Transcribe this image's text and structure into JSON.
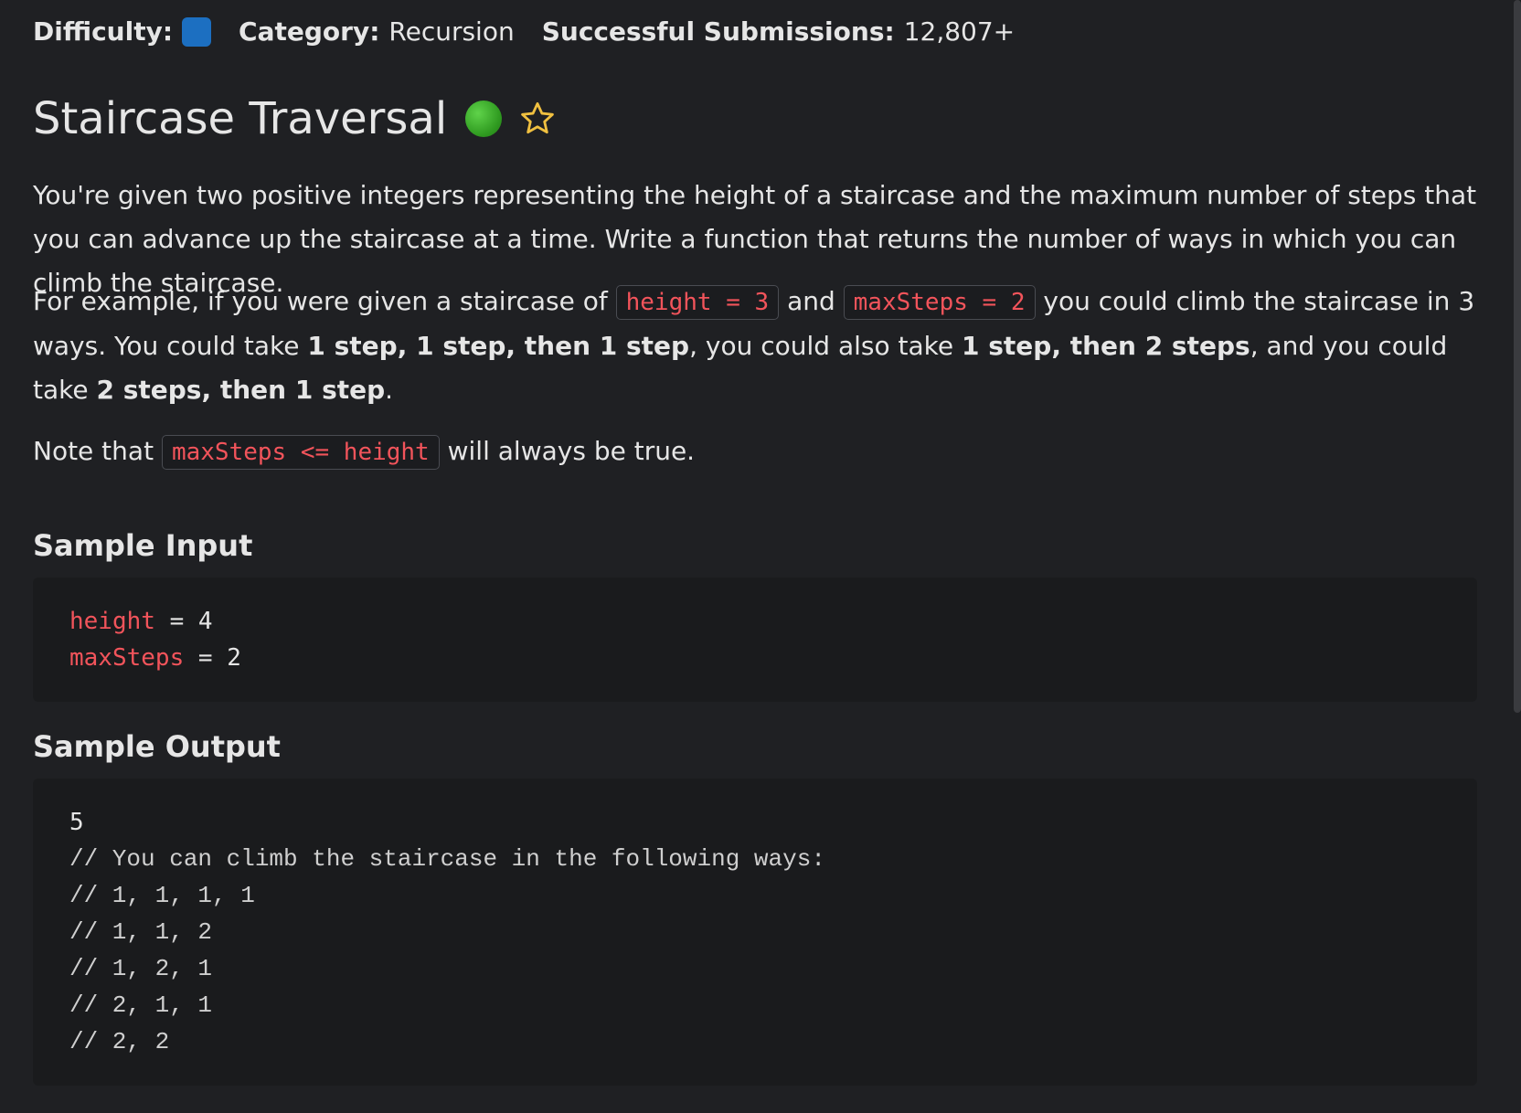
{
  "meta": {
    "difficulty_label": "Difficulty:",
    "difficulty_color": "#1c6fc1",
    "category_label": "Category:",
    "category_value": "Recursion",
    "submissions_label": "Successful Submissions:",
    "submissions_value": "12,807+"
  },
  "title": "Staircase Traversal",
  "status_icon": "green-dot-icon",
  "favorite_icon": "star-icon",
  "description": {
    "p1": "You're given two positive integers representing the height of a staircase and the maximum number of steps that you can advance up the staircase at a time. Write a function that returns the number of ways in which you can climb the staircase.",
    "p2_a": "For example, if you were given a staircase of ",
    "p2_code1": "height = 3",
    "p2_b": " and ",
    "p2_code2": "maxSteps = 2",
    "p2_c": " you could climb the staircase in 3 ways. You could take ",
    "p2_bold1": "1 step, 1 step, then 1 step",
    "p2_d": ", you could also take ",
    "p2_bold2": "1 step, then 2 steps",
    "p2_e": ", and you could take ",
    "p2_bold3": "2 steps, then 1 step",
    "p2_f": ".",
    "p3_a": "Note that ",
    "p3_code": "maxSteps <= height",
    "p3_b": " will always be true."
  },
  "sample_input": {
    "title": "Sample Input",
    "lines": [
      {
        "name": "height",
        "op": " = ",
        "value": "4"
      },
      {
        "name": "maxSteps",
        "op": " = ",
        "value": "2"
      }
    ]
  },
  "sample_output": {
    "title": "Sample Output",
    "result": "5",
    "comments": [
      "// You can climb the staircase in the following ways:",
      "// 1, 1, 1, 1",
      "// 1, 1, 2",
      "// 1, 2, 1",
      "// 2, 1, 1",
      "// 2, 2"
    ]
  },
  "colors": {
    "background": "#1f2023",
    "code_red": "#f2545b",
    "code_block_bg": "#1a1b1d"
  }
}
